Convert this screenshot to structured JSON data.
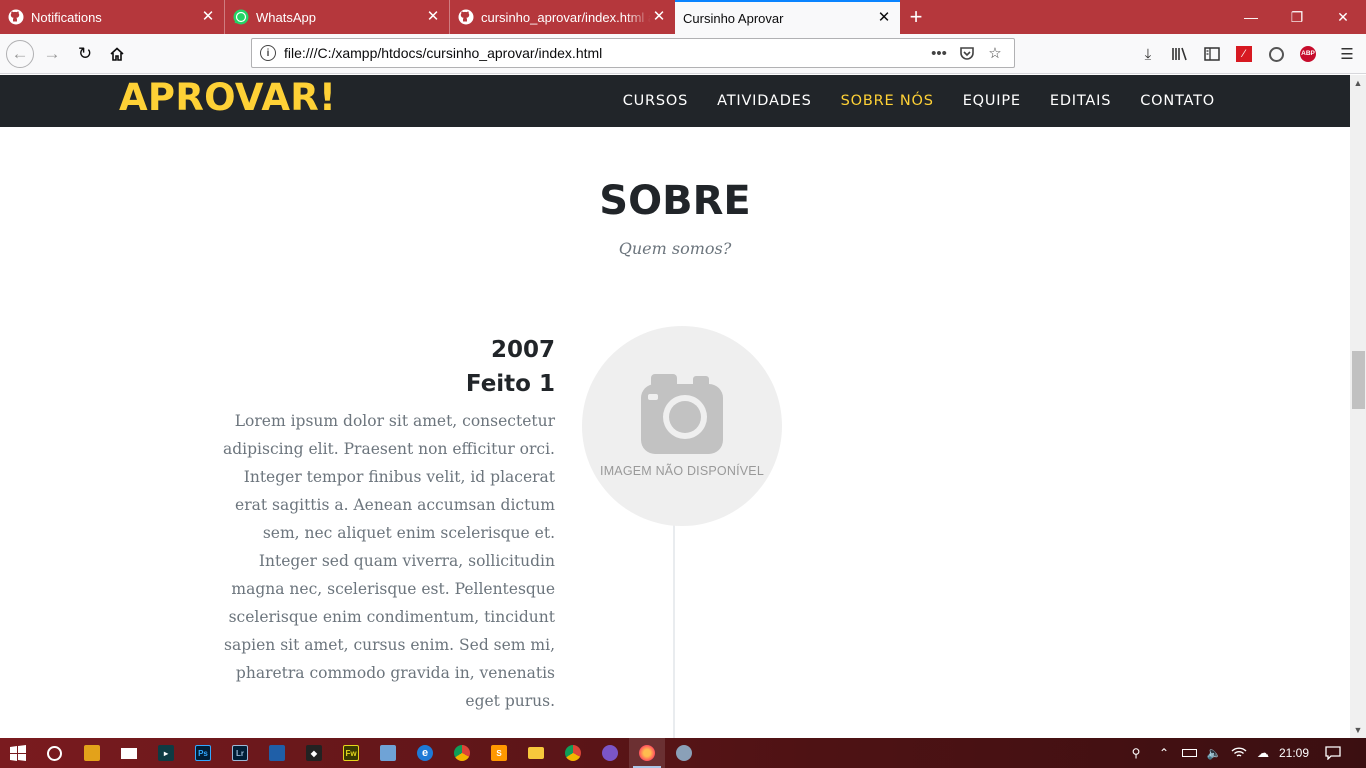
{
  "browser": {
    "tabs": [
      {
        "label": "Notifications",
        "icon": "github-icon"
      },
      {
        "label": "WhatsApp",
        "icon": "whatsapp-icon"
      },
      {
        "label": "cursinho_aprovar/index.html at",
        "icon": "github-icon"
      },
      {
        "label": "Cursinho Aprovar",
        "icon": "none",
        "active": true
      }
    ],
    "new_tab": "+",
    "url": "file:///C:/xampp/htdocs/cursinho_aprovar/index.html",
    "url_more": "•••"
  },
  "site": {
    "logo": "APROVAR!",
    "nav": [
      {
        "label": "CURSOS"
      },
      {
        "label": "ATIVIDADES"
      },
      {
        "label": "SOBRE NÓS",
        "active": true
      },
      {
        "label": "EQUIPE"
      },
      {
        "label": "EDITAIS"
      },
      {
        "label": "CONTATO"
      }
    ],
    "colors": {
      "accent": "#fed136",
      "dark": "#212529",
      "muted": "#6c757d",
      "tab_bar": "#b5373c"
    }
  },
  "about": {
    "heading": "SOBRE",
    "subheading": "Quem somos?",
    "timeline": [
      {
        "year": "2007",
        "title": "Feito 1",
        "image_text": "IMAGEM NÃO DISPONÍVEL",
        "body": "Lorem ipsum dolor sit amet, consectetur adipiscing elit. Praesent non efficitur orci. Integer tempor finibus velit, id placerat erat sagittis a. Aenean accumsan dictum sem, nec aliquet enim scelerisque et. Integer sed quam viverra, sollicitudin magna nec, scelerisque est. Pellentesque scelerisque enim condimentum, tincidunt sapien sit amet, cursus enim. Sed sem mi, pharetra commodo gravida in, venenatis eget purus."
      }
    ]
  },
  "taskbar": {
    "apps": [
      "Ps",
      "Lr",
      "Fw"
    ],
    "clock": "21:09"
  }
}
